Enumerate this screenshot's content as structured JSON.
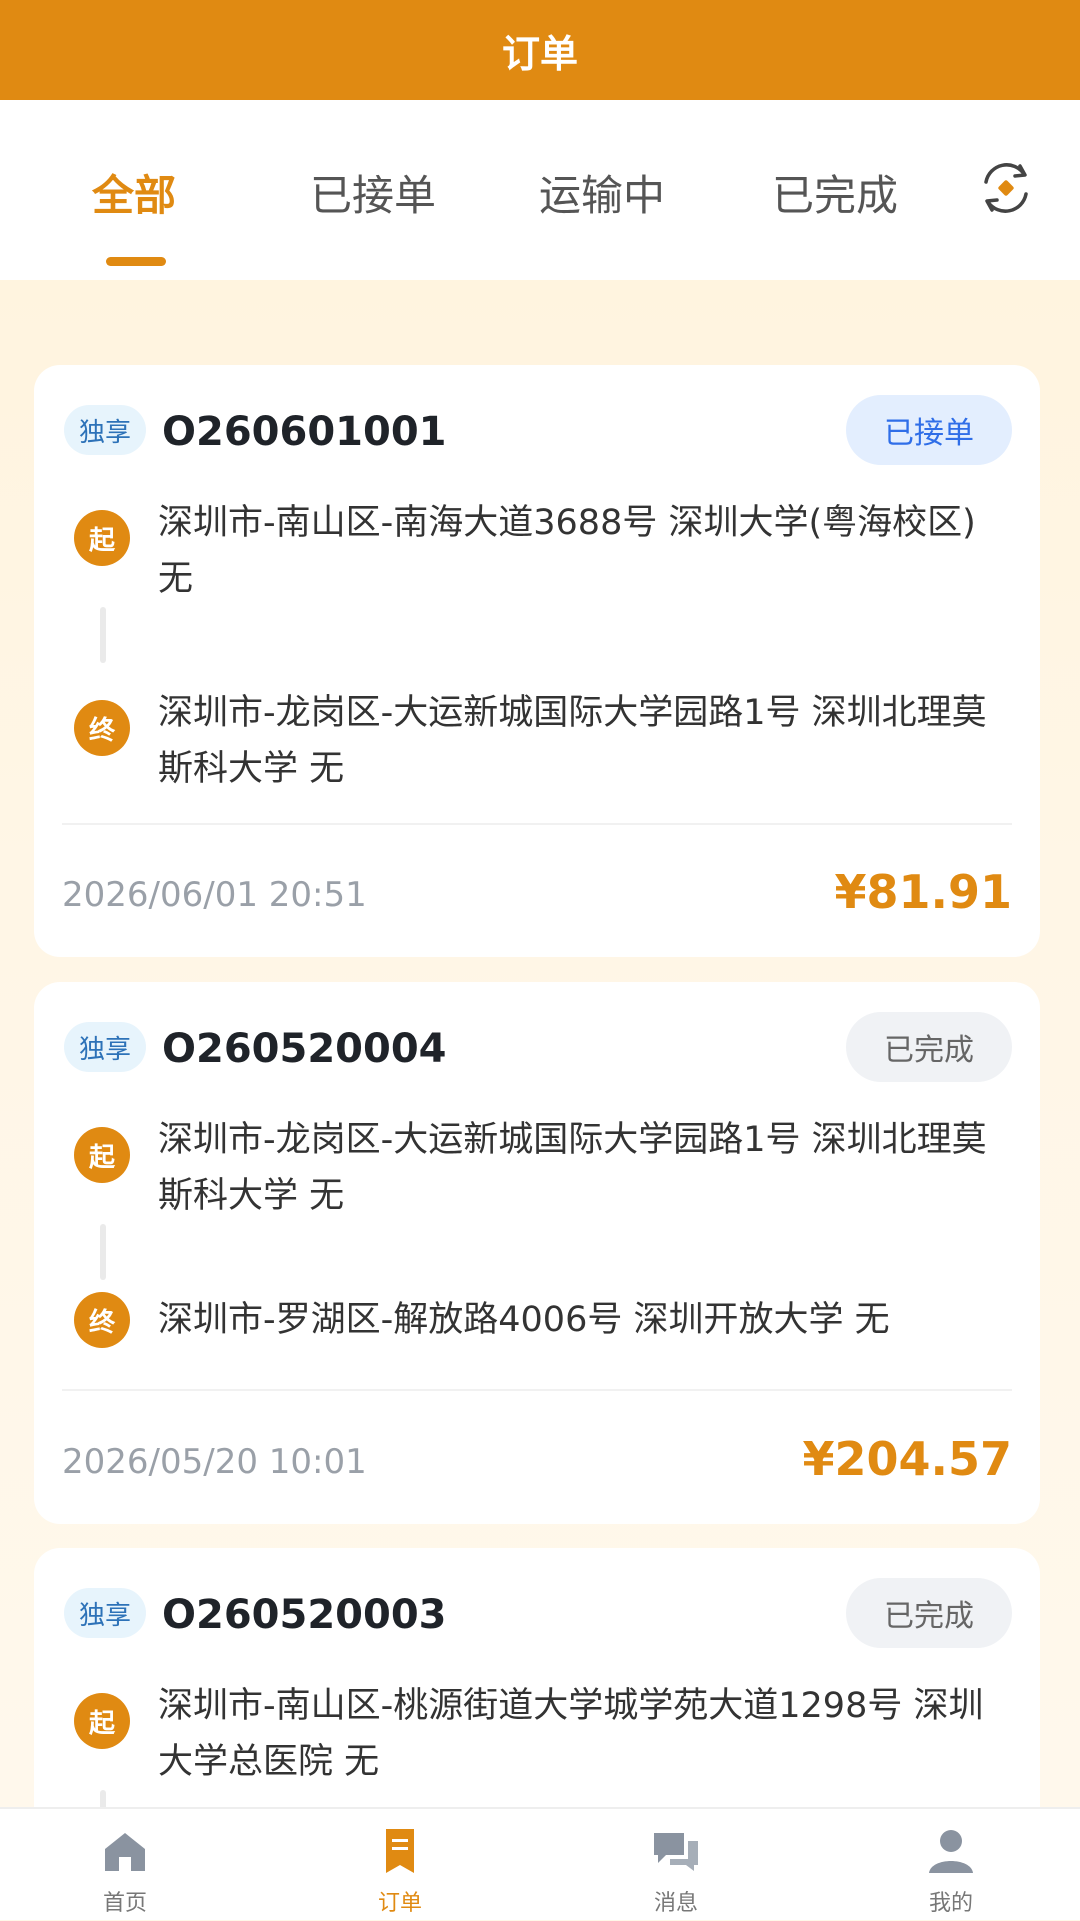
{
  "header": {
    "title": "订单"
  },
  "tabs": {
    "items": [
      {
        "label": "全部",
        "active": true
      },
      {
        "label": "已接单",
        "active": false
      },
      {
        "label": "运输中",
        "active": false
      },
      {
        "label": "已完成",
        "active": false
      }
    ],
    "scan_icon": "scan-icon"
  },
  "orders": [
    {
      "badge": "独享",
      "order_no": "O260601001",
      "status": "已接单",
      "start_mark": "起",
      "end_mark": "终",
      "start": "深圳市-南山区-南海大道3688号 深圳大学(粤海校区) 无",
      "end": "深圳市-龙岗区-大运新城国际大学园路1号 深圳北理莫斯科大学 无",
      "date": "2026/06/01 20:51",
      "price": "¥81.91"
    },
    {
      "badge": "独享",
      "order_no": "O260520004",
      "status": "已完成",
      "start_mark": "起",
      "end_mark": "终",
      "start": "深圳市-龙岗区-大运新城国际大学园路1号 深圳北理莫斯科大学 无",
      "end": "深圳市-罗湖区-解放路4006号 深圳开放大学 无",
      "date": "2026/05/20 10:01",
      "price": "¥204.57"
    },
    {
      "badge": "独享",
      "order_no": "O260520003",
      "status": "已完成",
      "start_mark": "起",
      "start": "深圳市-南山区-桃源街道大学城学苑大道1298号 深圳大学总医院 无"
    }
  ],
  "nav": {
    "items": [
      {
        "label": "首页",
        "icon": "home-icon",
        "active": false
      },
      {
        "label": "订单",
        "icon": "order-icon",
        "active": true
      },
      {
        "label": "消息",
        "icon": "message-icon",
        "active": false
      },
      {
        "label": "我的",
        "icon": "profile-icon",
        "active": false
      }
    ]
  },
  "colors": {
    "accent": "#e08a12",
    "status_blue": "#2f6ee8",
    "badge_blue": "#2d72b8"
  }
}
